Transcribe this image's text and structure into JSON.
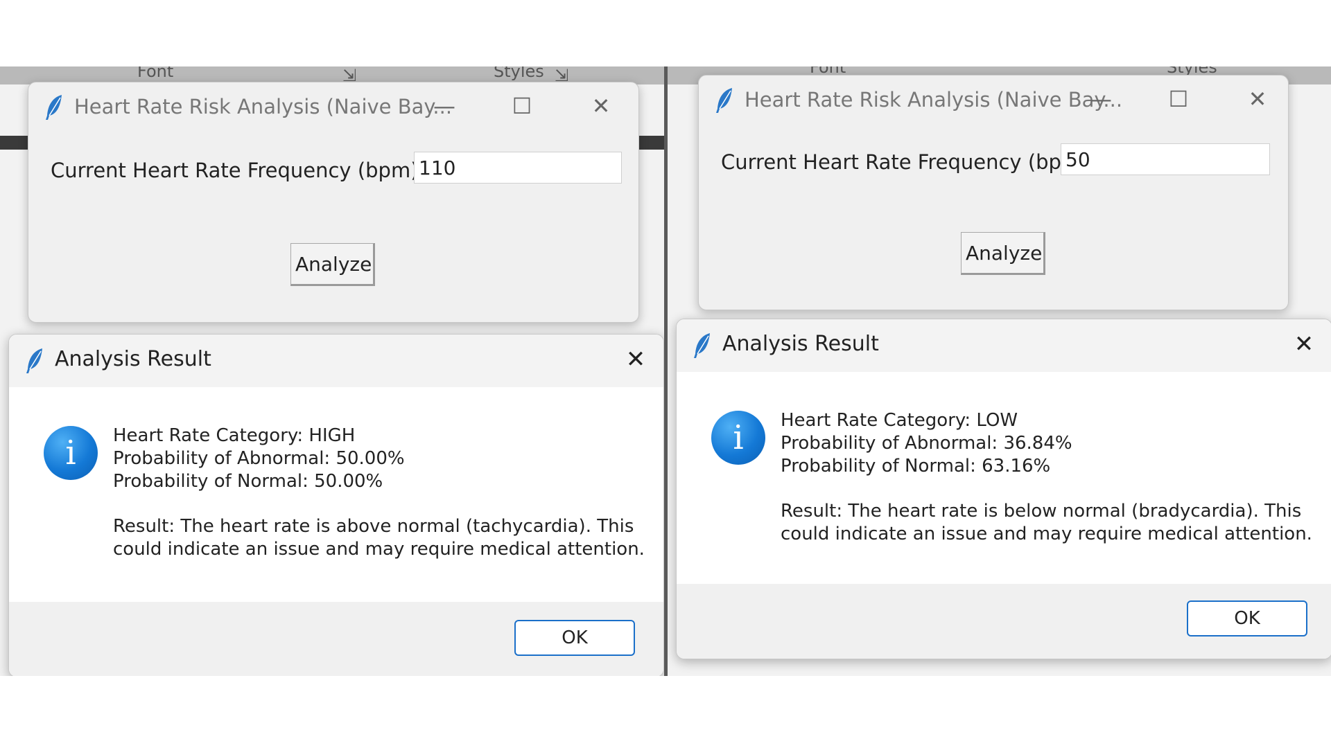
{
  "left": {
    "ribbon": {
      "font_label": "Font",
      "styles_label": "Styles"
    },
    "app_window": {
      "title": "Heart Rate Risk Analysis (Naive Bay...",
      "field_label": "Current Heart Rate Frequency (bpm):",
      "heart_rate_value": "110",
      "analyze_label": "Analyze"
    },
    "dialog": {
      "title": "Analysis Result",
      "category": "Heart Rate Category: HIGH",
      "prob_abnormal": "Probability of Abnormal: 50.00%",
      "prob_normal": "Probability of Normal: 50.00%",
      "result_line1": "Result: The heart rate is above normal (tachycardia). This",
      "result_line2": "could indicate an issue and may require medical attention.",
      "ok_label": "OK"
    }
  },
  "right": {
    "ribbon": {
      "font_label": "Font",
      "styles_label": "Styles"
    },
    "app_window": {
      "title": "Heart Rate Risk Analysis (Naive Bay...",
      "field_label": "Current Heart Rate Frequency (bpm):",
      "heart_rate_value": "50",
      "analyze_label": "Analyze"
    },
    "dialog": {
      "title": "Analysis Result",
      "category": "Heart Rate Category: LOW",
      "prob_abnormal": "Probability of Abnormal: 36.84%",
      "prob_normal": "Probability of Normal: 63.16%",
      "result_line1": "Result: The heart rate is below normal (bradycardia). This",
      "result_line2": "could indicate an issue and may require medical attention.",
      "ok_label": "OK"
    }
  },
  "icons": {
    "app_icon": "feather-icon",
    "minimize": "minimize-icon",
    "maximize": "maximize-icon",
    "close": "close-icon",
    "info": "info-icon"
  },
  "colors": {
    "info_icon_blue": "#1479d6",
    "ok_border": "#1a6fc9"
  }
}
